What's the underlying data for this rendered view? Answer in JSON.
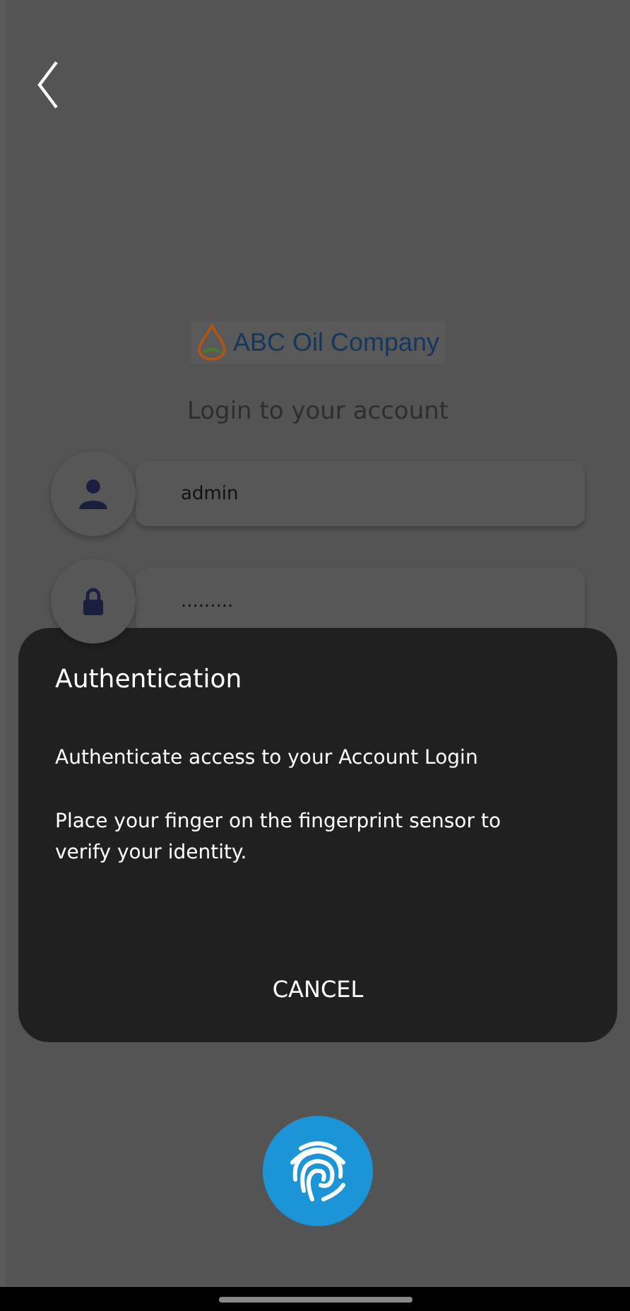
{
  "logo": {
    "text": "ABC Oil Company"
  },
  "title": "Login to your account",
  "fields": [
    {
      "kind": "user",
      "value": "admin"
    },
    {
      "kind": "password",
      "value": "........."
    }
  ],
  "dialog": {
    "title": "Authentication",
    "subtitle": "Authenticate access to your Account Login",
    "description": "Place your finger on the fingerprint sensor to verify your identity.",
    "button": "CANCEL"
  }
}
